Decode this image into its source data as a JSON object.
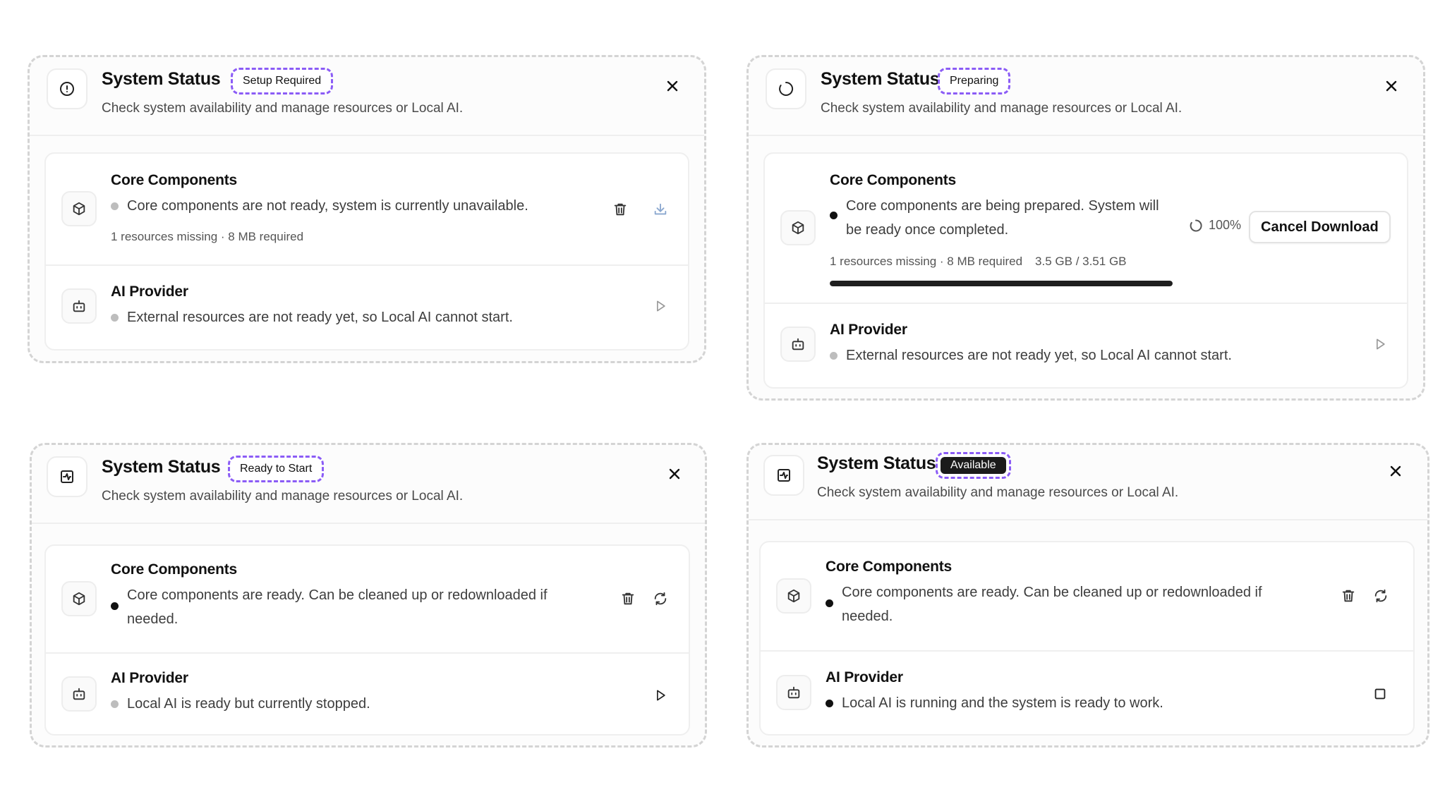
{
  "common": {
    "title": "System Status",
    "subtitle": "Check system availability and manage resources or Local AI.",
    "core_title": "Core Components",
    "ai_title": "AI Provider"
  },
  "panels": [
    {
      "badge": "Setup Required",
      "header_icon": "alert-circle-icon",
      "core_desc": "Core components are not ready, system is currently unavailable.",
      "core_status_color": "#bdbdbd",
      "core_meta": "1 resources missing · 8 MB required",
      "core_actions": [
        "trash-icon",
        "download-icon"
      ],
      "ai_desc": "External resources are not ready yet, so Local AI cannot start.",
      "ai_status_color": "#bdbdbd",
      "ai_action": "play-icon"
    },
    {
      "badge": "Preparing",
      "header_icon": "loader-icon",
      "core_desc": "Core components are being prepared. System will be ready once completed.",
      "core_status_color": "#111111",
      "core_meta": "1 resources missing · 8 MB required",
      "core_size": "3.5 GB / 3.51 GB",
      "progress_percent": 100,
      "progress_label": "100%",
      "cancel_label": "Cancel Download",
      "ai_desc": "External resources are not ready yet, so Local AI cannot start.",
      "ai_status_color": "#bdbdbd",
      "ai_action": "play-icon"
    },
    {
      "badge": "Ready to Start",
      "header_icon": "activity-square-icon",
      "core_desc": "Core components are ready. Can be cleaned up or redownloaded if needed.",
      "core_status_color": "#111111",
      "core_actions": [
        "trash-icon",
        "refresh-icon"
      ],
      "ai_desc": "Local AI is ready but currently stopped.",
      "ai_status_color": "#bdbdbd",
      "ai_action": "play-icon"
    },
    {
      "badge": "Available",
      "header_icon": "activity-square-icon",
      "core_desc": "Core components are ready. Can be cleaned up or redownloaded if needed.",
      "core_status_color": "#111111",
      "core_actions": [
        "trash-icon",
        "refresh-icon"
      ],
      "ai_desc": "Local AI is running and the system is ready to work.",
      "ai_status_color": "#111111",
      "ai_action": "stop-icon"
    }
  ],
  "colors": {
    "badge_border": "#8b5cf6",
    "panel_border": "#d4d4d4",
    "badge_dark_bg": "#1b1b1b"
  }
}
